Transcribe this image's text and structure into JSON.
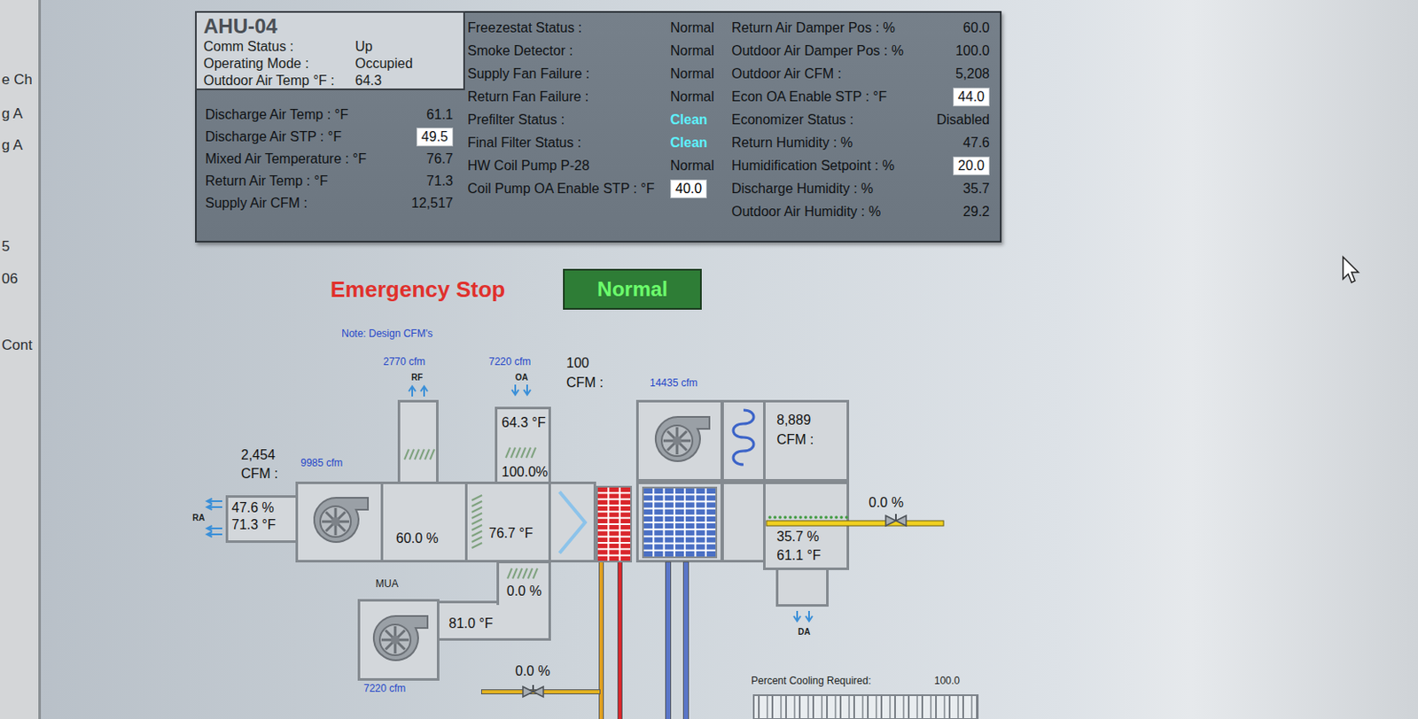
{
  "sidebar": {
    "items": [
      "e Ch",
      "g A",
      "g A",
      "5",
      "06",
      "Cont"
    ]
  },
  "header": {
    "title": "AHU-04",
    "fields": [
      {
        "label": "Comm Status :",
        "value": "Up"
      },
      {
        "label": "Operating Mode :",
        "value": "Occupied"
      },
      {
        "label": "Outdoor Air Temp °F :",
        "value": "64.3"
      }
    ]
  },
  "readings": [
    {
      "label": "Discharge Air Temp : °F",
      "value": "61.1",
      "editable": false
    },
    {
      "label": "Discharge Air STP : °F",
      "value": "49.5",
      "editable": true
    },
    {
      "label": "Mixed Air Temperature : °F",
      "value": "76.7",
      "editable": false
    },
    {
      "label": "Return Air Temp : °F",
      "value": "71.3",
      "editable": false
    },
    {
      "label": "Supply Air CFM :",
      "value": "12,517",
      "editable": false
    }
  ],
  "statuses": [
    {
      "label": "Freezestat Status :",
      "value": "Normal",
      "editable": false,
      "color": "#0e1114"
    },
    {
      "label": "Smoke Detector :",
      "value": "Normal",
      "editable": false,
      "color": "#0e1114"
    },
    {
      "label": "Supply Fan Failure :",
      "value": "Normal",
      "editable": false,
      "color": "#0e1114"
    },
    {
      "label": "Return Fan Failure :",
      "value": "Normal",
      "editable": false,
      "color": "#0e1114"
    },
    {
      "label": "Prefilter Status :",
      "value": "Clean",
      "editable": false,
      "color": "#5ef2ff"
    },
    {
      "label": "Final Filter Status :",
      "value": "Clean",
      "editable": false,
      "color": "#5ef2ff"
    },
    {
      "label": "HW Coil Pump P-28",
      "value": "Normal",
      "editable": false,
      "color": "#0e1114"
    },
    {
      "label": "Coil Pump OA Enable STP : °F",
      "value": "40.0",
      "editable": true,
      "color": "#000000"
    }
  ],
  "controls": [
    {
      "label": "Return Air Damper Pos : %",
      "value": "60.0",
      "editable": false
    },
    {
      "label": "Outdoor Air Damper Pos : %",
      "value": "100.0",
      "editable": false
    },
    {
      "label": "Outdoor Air CFM :",
      "value": "5,208",
      "editable": false
    },
    {
      "label": "Econ OA Enable STP : °F",
      "value": "44.0",
      "editable": true
    },
    {
      "label": "Economizer Status :",
      "value": "Disabled",
      "editable": false
    },
    {
      "label": "Return Humidity : %",
      "value": "47.6",
      "editable": false
    },
    {
      "label": "Humidification Setpoint : %",
      "value": "20.0",
      "editable": true
    },
    {
      "label": "Discharge Humidity : %",
      "value": "35.7",
      "editable": false
    },
    {
      "label": "Outdoor Air Humidity : %",
      "value": "29.2",
      "editable": false
    }
  ],
  "emergency_stop": {
    "label": "Emergency Stop",
    "status": "Normal"
  },
  "diagram": {
    "note": "Note: Design CFM's",
    "relief": {
      "tag": "RF",
      "design_cfm": "2770 cfm"
    },
    "outdoor_air": {
      "tag": "OA",
      "design_cfm": "7220 cfm",
      "cfm": "100",
      "cfm_label": "CFM :",
      "temp": "64.3 °F",
      "damper": "100.0%"
    },
    "return_air": {
      "tag": "RA",
      "humidity": "47.6 %",
      "temp": "71.3 °F",
      "cfm": "2,454",
      "cfm_label": "CFM :",
      "design_cfm": "9985 cfm"
    },
    "return_damper": {
      "position": "60.0 %"
    },
    "mixed_air": {
      "temp": "76.7 °F"
    },
    "supply_fan": {
      "design_cfm": "14435 cfm",
      "cfm": "8,889",
      "cfm_label": "CFM :"
    },
    "discharge": {
      "tag": "DA",
      "humidity": "35.7 %",
      "temp": "61.1 °F"
    },
    "humidifier_valve": {
      "position": "0.0 %"
    },
    "makeup_air": {
      "tag": "MUA",
      "damper": "0.0 %",
      "temp": "81.0 °F",
      "design_cfm": "7220 cfm"
    },
    "heating_valve": {
      "position": "0.0 %"
    },
    "cooling": {
      "label": "Percent Cooling Required:",
      "value": "100.0"
    }
  }
}
